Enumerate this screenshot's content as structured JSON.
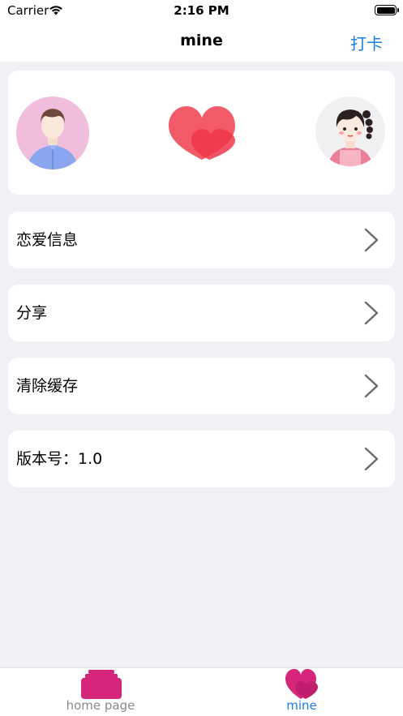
{
  "status_bar": {
    "carrier": "Carrier",
    "time": "2:16 PM"
  },
  "nav": {
    "title": "mine",
    "action_label": "打卡"
  },
  "couple": {
    "left_avatar": "boy-avatar-icon",
    "center": "hearts-icon",
    "right_avatar": "girl-avatar-icon"
  },
  "menu": {
    "items": [
      {
        "label": "恋爱信息"
      },
      {
        "label": "分享"
      },
      {
        "label": "清除缓存"
      },
      {
        "label": "版本号：1.0"
      }
    ]
  },
  "tab_bar": {
    "tabs": [
      {
        "label": "home page",
        "selected": false
      },
      {
        "label": "mine",
        "selected": true
      }
    ]
  },
  "colors": {
    "accent": "#1a7fe5",
    "tab_icon": "#d6267a",
    "heart": "#f25a67"
  }
}
